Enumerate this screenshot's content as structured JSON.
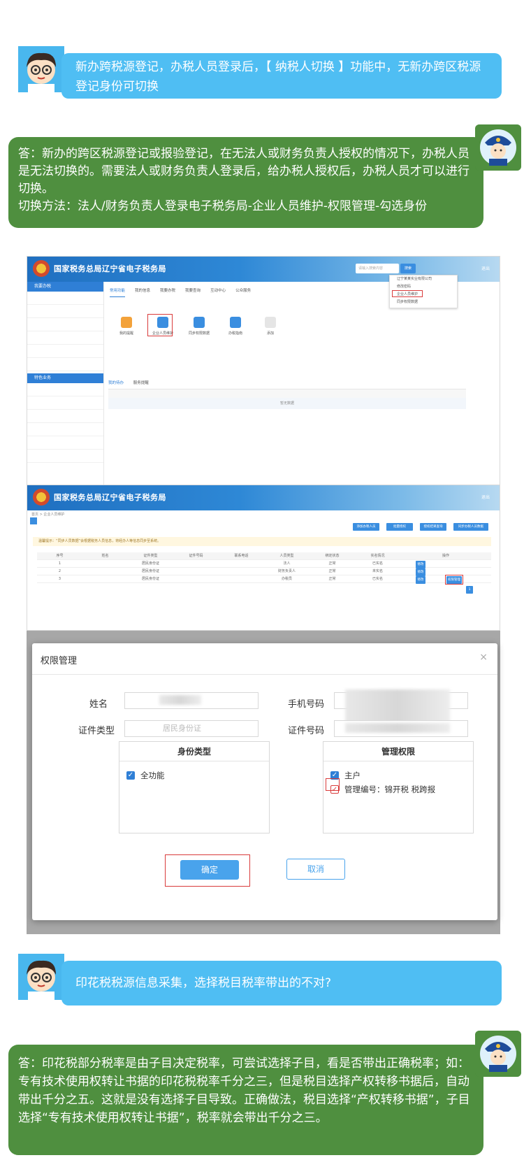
{
  "q1": {
    "text": "新办跨税源登记，办税人员登录后，【 纳税人切换 】功能中，无新办跨区税源登记身份可切换"
  },
  "a1": {
    "line1": "答：新办的跨区税源登记或报验登记，在无法人或财务负责人授权的情况下，办税人员是无法切换的。需要法人或财务负责人登录后，给办税人授权后，办税人员才可以进行切换。",
    "line2": "切换方法：法人/财务负责人登录电子税务局-企业人员维护-权限管理-勾选身份"
  },
  "screenshot1": {
    "site_title": "国家税务总局辽宁省电子税务局",
    "search_placeholder": "请输入搜索内容",
    "search_button": "搜索",
    "logout": "退出",
    "sidebar_head_1": "我要办税",
    "sidebar_head_2": "特色业务",
    "tabs": [
      "常用功能",
      "我的信息",
      "我要办税",
      "我要查询",
      "互动中心",
      "公众服务"
    ],
    "tiles": [
      "我的提醒",
      "企业人员维护",
      "同步权限数据",
      "办税指南",
      "添加"
    ],
    "dropdown_items": [
      "辽宁某某实业有限公司",
      "修改密码",
      "企业人员维护",
      "同步权限数据"
    ],
    "panel_tabs": [
      "我的待办",
      "服务提醒"
    ],
    "empty_text": "暂无数据"
  },
  "screenshot2": {
    "site_title": "国家税务总局辽宁省电子税务局",
    "breadcrumb": "首页 > 企业人员维护",
    "notice": "温馨提示：“同步人员数据”会根据税务人员信息，将经办人等信息同步至系统。",
    "top_buttons": [
      "添加办税人员",
      "批量授权",
      "授权结果查询",
      "同步办税人员数据"
    ],
    "headers": [
      "序号",
      "姓名",
      "证件类型",
      "证件号码",
      "联系电话",
      "人员类型",
      "绑定状态",
      "实名情况",
      "操作"
    ],
    "rows": [
      [
        "1",
        "",
        "居民身份证",
        "",
        "",
        "法人",
        "正常",
        "已实名"
      ],
      [
        "2",
        "",
        "居民身份证",
        "",
        "",
        "财务负责人",
        "正常",
        "未实名"
      ],
      [
        "3",
        "",
        "居民身份证",
        "",
        "",
        "办税员",
        "正常",
        "已实名"
      ]
    ],
    "row_buttons": [
      "权限管理",
      "修改",
      "注销"
    ],
    "pager": "1"
  },
  "modal": {
    "title": "权限管理",
    "name_label": "姓名",
    "phone_label": "手机号码",
    "idtype_label": "证件类型",
    "idtype_value": "居民身份证",
    "idno_label": "证件号码",
    "identity_group_title": "身份类型",
    "identity_option": "全功能",
    "perm_group_title": "管理权限",
    "perm_option_1": "主户",
    "perm_option_2": "管理编号：锦开税 税跨报",
    "ok": "确定",
    "cancel": "取消"
  },
  "q2": {
    "text": "印花税税源信息采集，选择税目税率带出的不对?"
  },
  "a2": {
    "text": "答：印花税部分税率是由子目决定税率，可尝试选择子目，看是否带出正确税率；如：专有技术使用权转让书据的印花税税率千分之三，但是税目选择产权转移书据后，自动带出千分之五。这就是没有选择子目导致。正确做法，税目选择“产权转移书据”，子目选择“专有技术使用权转让书据”，税率就会带出千分之三。"
  },
  "colors": {
    "question_bubble": "#4fbef3",
    "answer_bubble": "#4f8f3f",
    "accent_blue": "#2f7fd6",
    "highlight_red": "#d93b3b"
  }
}
